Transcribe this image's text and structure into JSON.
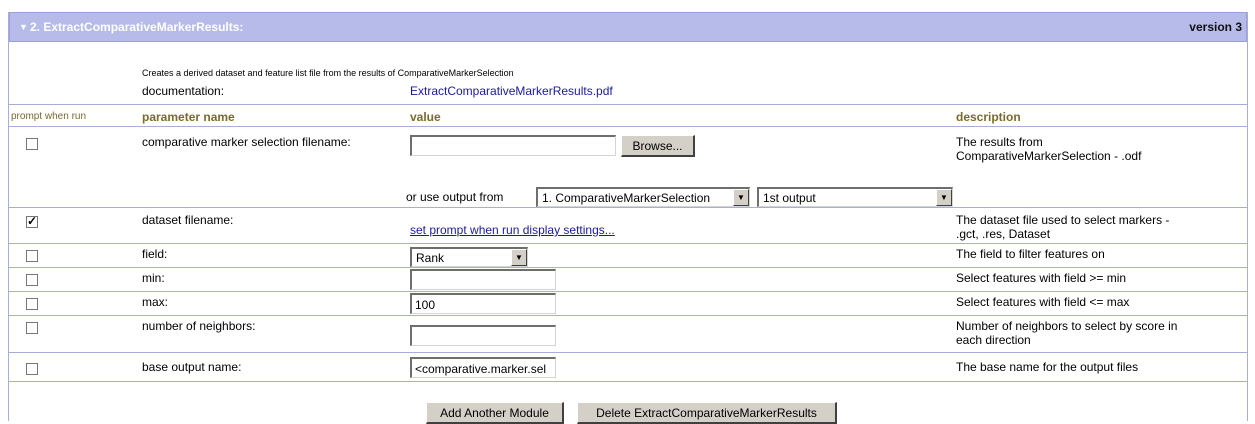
{
  "header": {
    "title": "2. ExtractComparativeMarkerResults:",
    "version": "version 3"
  },
  "module": {
    "description": "Creates a derived dataset and feature list file from the results of ComparativeMarkerSelection",
    "documentation_label": "documentation:",
    "documentation_link": "ExtractComparativeMarkerResults.pdf"
  },
  "columns": {
    "prompt": "prompt when run",
    "name": "parameter name",
    "value": "value",
    "description": "description"
  },
  "params": {
    "cms_file": {
      "name": "comparative marker selection filename:",
      "value": "",
      "browse_label": "Browse...",
      "or_use_label": "or use output from",
      "module_select": "1. ComparativeMarkerSelection",
      "output_select": "1st output",
      "desc_line1": "The results from",
      "desc_line2": "ComparativeMarkerSelection - .odf",
      "prompt_checked": false
    },
    "dataset": {
      "name": "dataset filename:",
      "link": "set prompt when run display settings...",
      "desc_line1": "The dataset file used to select markers -",
      "desc_line2": ".gct, .res, Dataset",
      "prompt_checked": true
    },
    "field": {
      "name": "field:",
      "value": "Rank",
      "desc": "The field to filter features on",
      "prompt_checked": false
    },
    "min": {
      "name": "min:",
      "value": "",
      "desc": "Select features with field >= min",
      "prompt_checked": false
    },
    "max": {
      "name": "max:",
      "value": "100",
      "desc": "Select features with field <= max",
      "prompt_checked": false
    },
    "neighbors": {
      "name": "number of neighbors:",
      "value": "",
      "desc_line1": "Number of neighbors to select by score in",
      "desc_line2": "each direction",
      "prompt_checked": false
    },
    "base_output": {
      "name": "base output name:",
      "value": "<comparative.marker.sel",
      "desc": "The base name for the output files",
      "prompt_checked": false
    }
  },
  "actions": {
    "add_module": "Add Another Module",
    "delete_module": "Delete ExtractComparativeMarkerResults"
  }
}
